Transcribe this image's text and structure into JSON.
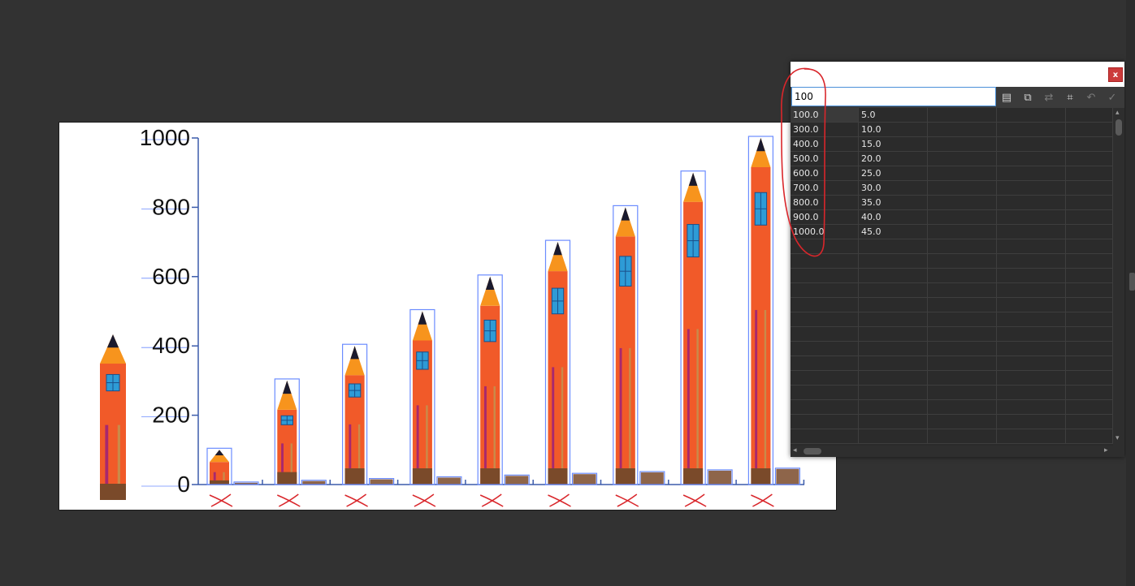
{
  "chart_data": {
    "type": "bar",
    "categories": [
      "",
      "",
      "",
      "",
      "",
      "",
      "",
      "",
      ""
    ],
    "series": [
      {
        "name": "",
        "values": [
          100,
          300,
          400,
          500,
          600,
          700,
          800,
          900,
          1000
        ]
      },
      {
        "name": "",
        "values": [
          5,
          10,
          15,
          20,
          25,
          30,
          35,
          40,
          45
        ]
      }
    ],
    "y_ticks": [
      "1000",
      "800",
      "600",
      "400",
      "200",
      "0"
    ],
    "ylim": [
      0,
      1000
    ],
    "title": "",
    "xlabel": "",
    "ylabel": "",
    "bar_color": "#f15a29",
    "tip_color": "#f7941d",
    "lead_color": "#1a1a2e",
    "window_color": "#2e9bd6",
    "base_color": "#7a4a2a",
    "stripe_color": "#a8286e",
    "selection_color": "#6b8cff",
    "annotation_color": "#d9262b"
  },
  "data_window": {
    "close_label": "x",
    "cell_input_value": "100",
    "toolbar_icons": [
      "import-data-icon",
      "transpose-icon",
      "switch-xy-icon",
      "cell-style-icon",
      "revert-icon",
      "apply-icon"
    ],
    "rows": [
      [
        "100.0",
        "5.0"
      ],
      [
        "300.0",
        "10.0"
      ],
      [
        "400.0",
        "15.0"
      ],
      [
        "500.0",
        "20.0"
      ],
      [
        "600.0",
        "25.0"
      ],
      [
        "700.0",
        "30.0"
      ],
      [
        "800.0",
        "35.0"
      ],
      [
        "900.0",
        "40.0"
      ],
      [
        "1000.0",
        "45.0"
      ]
    ],
    "column_count": 5,
    "row_count": 23
  }
}
